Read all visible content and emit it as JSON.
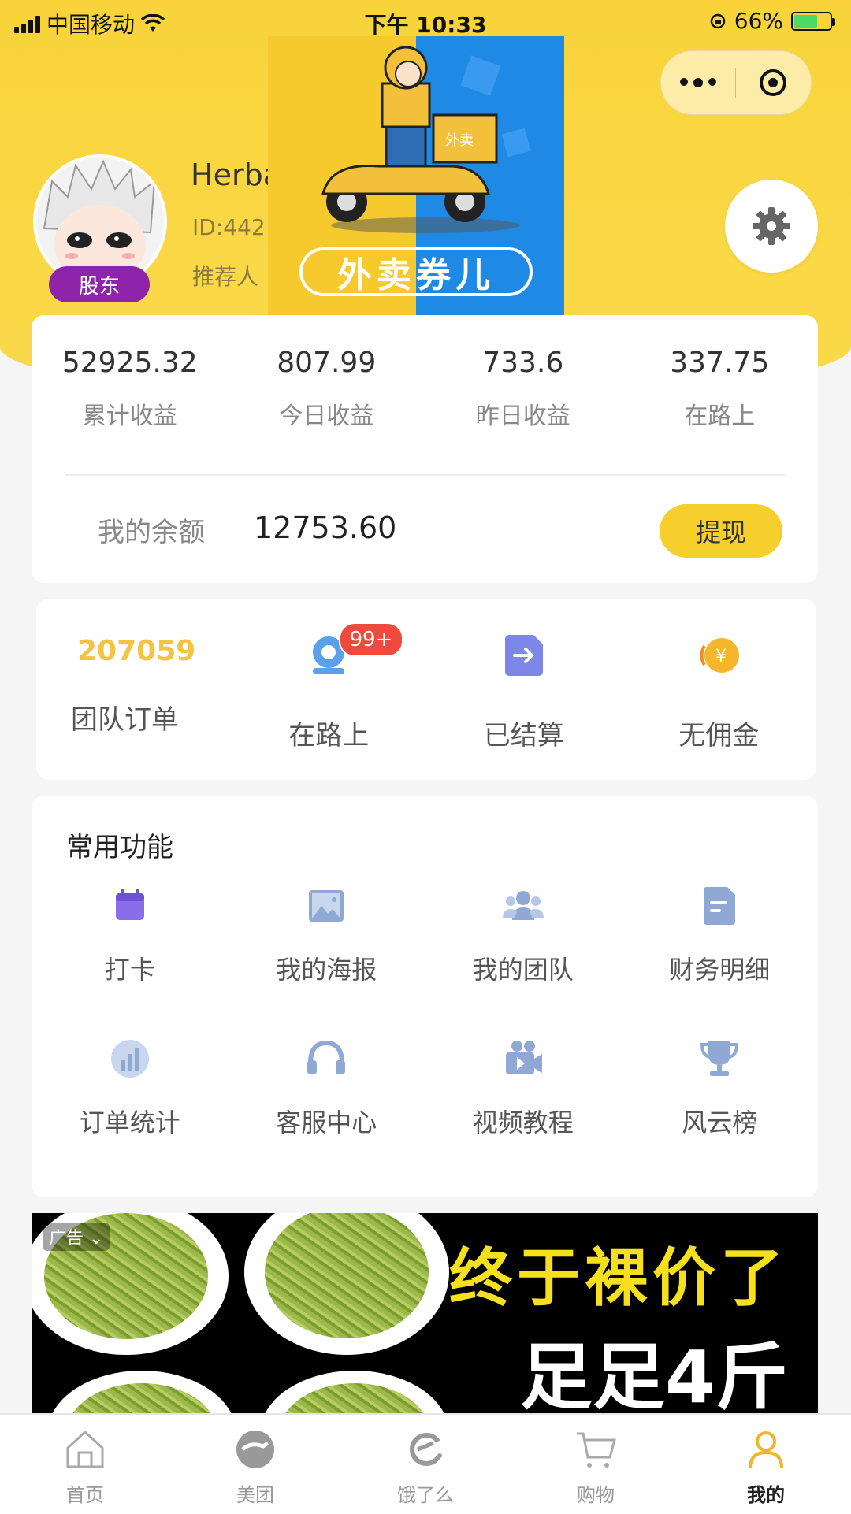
{
  "status_bar": {
    "carrier": "中国移动",
    "time": "下午 10:33",
    "battery": "66%"
  },
  "profile": {
    "name": "Herba",
    "id": "ID:442",
    "referrer": "推荐人",
    "badge": "股东"
  },
  "overlay_ad": {
    "slogan": "外卖券儿",
    "box_text": "外卖"
  },
  "earnings": {
    "stats": [
      {
        "value": "52925.32",
        "label": "累计收益"
      },
      {
        "value": "807.99",
        "label": "今日收益"
      },
      {
        "value": "733.6",
        "label": "昨日收益"
      },
      {
        "value": "337.75",
        "label": "在路上"
      }
    ],
    "balance_label": "我的余额",
    "balance_value": "12753.60",
    "withdraw_label": "提现"
  },
  "orders": {
    "team_count": "207059",
    "team_label": "团队订单",
    "items": [
      {
        "label": "在路上",
        "badge": "99+",
        "icon": "on-the-way-icon"
      },
      {
        "label": "已结算",
        "icon": "settled-icon"
      },
      {
        "label": "无佣金",
        "icon": "no-commission-icon"
      }
    ]
  },
  "functions": {
    "title": "常用功能",
    "items": [
      {
        "label": "打卡",
        "icon": "calendar-icon"
      },
      {
        "label": "我的海报",
        "icon": "image-icon"
      },
      {
        "label": "我的团队",
        "icon": "team-icon"
      },
      {
        "label": "财务明细",
        "icon": "document-icon"
      },
      {
        "label": "订单统计",
        "icon": "bar-chart-icon"
      },
      {
        "label": "客服中心",
        "icon": "headset-icon"
      },
      {
        "label": "视频教程",
        "icon": "video-icon"
      },
      {
        "label": "风云榜",
        "icon": "trophy-icon"
      }
    ]
  },
  "banner": {
    "ad_tag": "广告",
    "line1": "终于裸价了",
    "line2": "足足4斤"
  },
  "tabbar": {
    "items": [
      {
        "label": "首页",
        "icon": "home-icon"
      },
      {
        "label": "美团",
        "icon": "meituan-icon"
      },
      {
        "label": "饿了么",
        "icon": "eleme-icon"
      },
      {
        "label": "购物",
        "icon": "cart-icon"
      },
      {
        "label": "我的",
        "icon": "person-icon",
        "active": true
      }
    ]
  },
  "colors": {
    "brand_yellow": "#f6cf2d",
    "badge_purple": "#8e24aa",
    "badge_red": "#f04a3e",
    "icon_blue": "#8fa8d4",
    "icon_purple": "#8a6de9"
  }
}
